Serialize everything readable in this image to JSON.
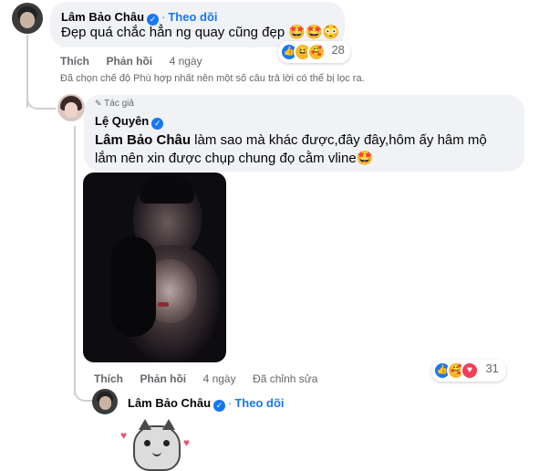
{
  "comment1": {
    "author": "Lâm Bảo Châu",
    "follow": "Theo dõi",
    "text": "Đẹp quá chắc hẳn ng quay cũng đẹp 🤩🤩😳",
    "reaction_count": "28",
    "actions": {
      "like": "Thích",
      "reply": "Phản hồi",
      "time": "4 ngày"
    }
  },
  "filter_note": "Đã chọn chế độ Phù hợp nhất nên một số câu trả lời có thể bị lọc ra.",
  "reply1": {
    "author_badge": "Tác giả",
    "author": "Lệ Quyên",
    "mention": "Lâm Bảo Châu",
    "text_line1": " làm sao mà khác được,đây đây,hôm ấy hâm mộ",
    "text_line2": "lắm nên xin được chụp chung đọ cằm vline🤩",
    "reaction_count": "31",
    "actions": {
      "like": "Thích",
      "reply": "Phản hồi",
      "time": "4 ngày",
      "edited": "Đã chỉnh sửa"
    }
  },
  "reply2": {
    "author": "Lâm Bảo Châu",
    "follow": "Theo dõi"
  },
  "colors": {
    "accent": "#1877f2",
    "bubble": "#f0f2f5",
    "muted": "#65676b"
  }
}
